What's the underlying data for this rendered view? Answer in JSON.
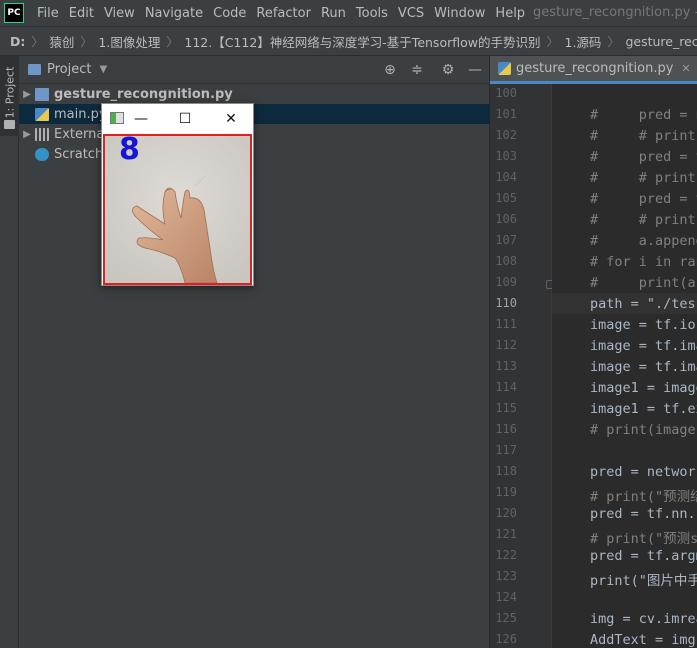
{
  "menubar": {
    "items": [
      "File",
      "Edit",
      "View",
      "Navigate",
      "Code",
      "Refactor",
      "Run",
      "Tools",
      "VCS",
      "Window",
      "Help"
    ],
    "window_title": "gesture_recongnition.py - D:"
  },
  "breadcrumb": [
    "D:",
    "猿创",
    "1.图像处理",
    "112.【C112】神经网络与深度学习-基于Tensorflow的手势识别",
    "1.源码",
    "gesture_recongnition"
  ],
  "left_strip": {
    "project_tab": "1: Project"
  },
  "project_panel": {
    "title": "Project",
    "tree": [
      {
        "label": "gesture_recongnition.py"
      },
      {
        "label": "main.py"
      },
      {
        "label": "External Libraries"
      },
      {
        "label": "Scratches and Consoles"
      }
    ]
  },
  "editor": {
    "tab": "gesture_recongnition.py",
    "current_line": 110,
    "lines": [
      {
        "n": 100,
        "text": ""
      },
      {
        "n": 101,
        "text": "#     pred = n"
      },
      {
        "n": 102,
        "text": "#     # print"
      },
      {
        "n": 103,
        "text": "#     pred = t"
      },
      {
        "n": 104,
        "text": "#     # print"
      },
      {
        "n": 105,
        "text": "#     pred = t"
      },
      {
        "n": 106,
        "text": "#     # print"
      },
      {
        "n": 107,
        "text": "#     a.append"
      },
      {
        "n": 108,
        "text": "# for i in ran"
      },
      {
        "n": 109,
        "text": "#     print(a"
      },
      {
        "n": 110,
        "text": "path = \"./tes"
      },
      {
        "n": 111,
        "text": "image = tf.io"
      },
      {
        "n": 112,
        "text": "image = tf.ima"
      },
      {
        "n": 113,
        "text": "image = tf.ima"
      },
      {
        "n": 114,
        "text": "image1 = image"
      },
      {
        "n": 115,
        "text": "image1 = tf.ex"
      },
      {
        "n": 116,
        "text": "# print(image)"
      },
      {
        "n": 117,
        "text": ""
      },
      {
        "n": 118,
        "text": "pred = network"
      },
      {
        "n": 119,
        "text": "# print(\"预测结"
      },
      {
        "n": 120,
        "text": "pred = tf.nn.s"
      },
      {
        "n": 121,
        "text": "# print(\"预测s"
      },
      {
        "n": 122,
        "text": "pred = tf.argm"
      },
      {
        "n": 123,
        "text": "print(\"图片中手"
      },
      {
        "n": 124,
        "text": ""
      },
      {
        "n": 125,
        "text": "img = cv.imrea"
      },
      {
        "n": 126,
        "text": "AddText = img"
      }
    ]
  },
  "image_window": {
    "prediction": "8"
  },
  "colors": {
    "accent": "#4a88c7",
    "selection": "#0d293e",
    "prediction_text": "#1515d8",
    "image_border": "#e02020"
  }
}
